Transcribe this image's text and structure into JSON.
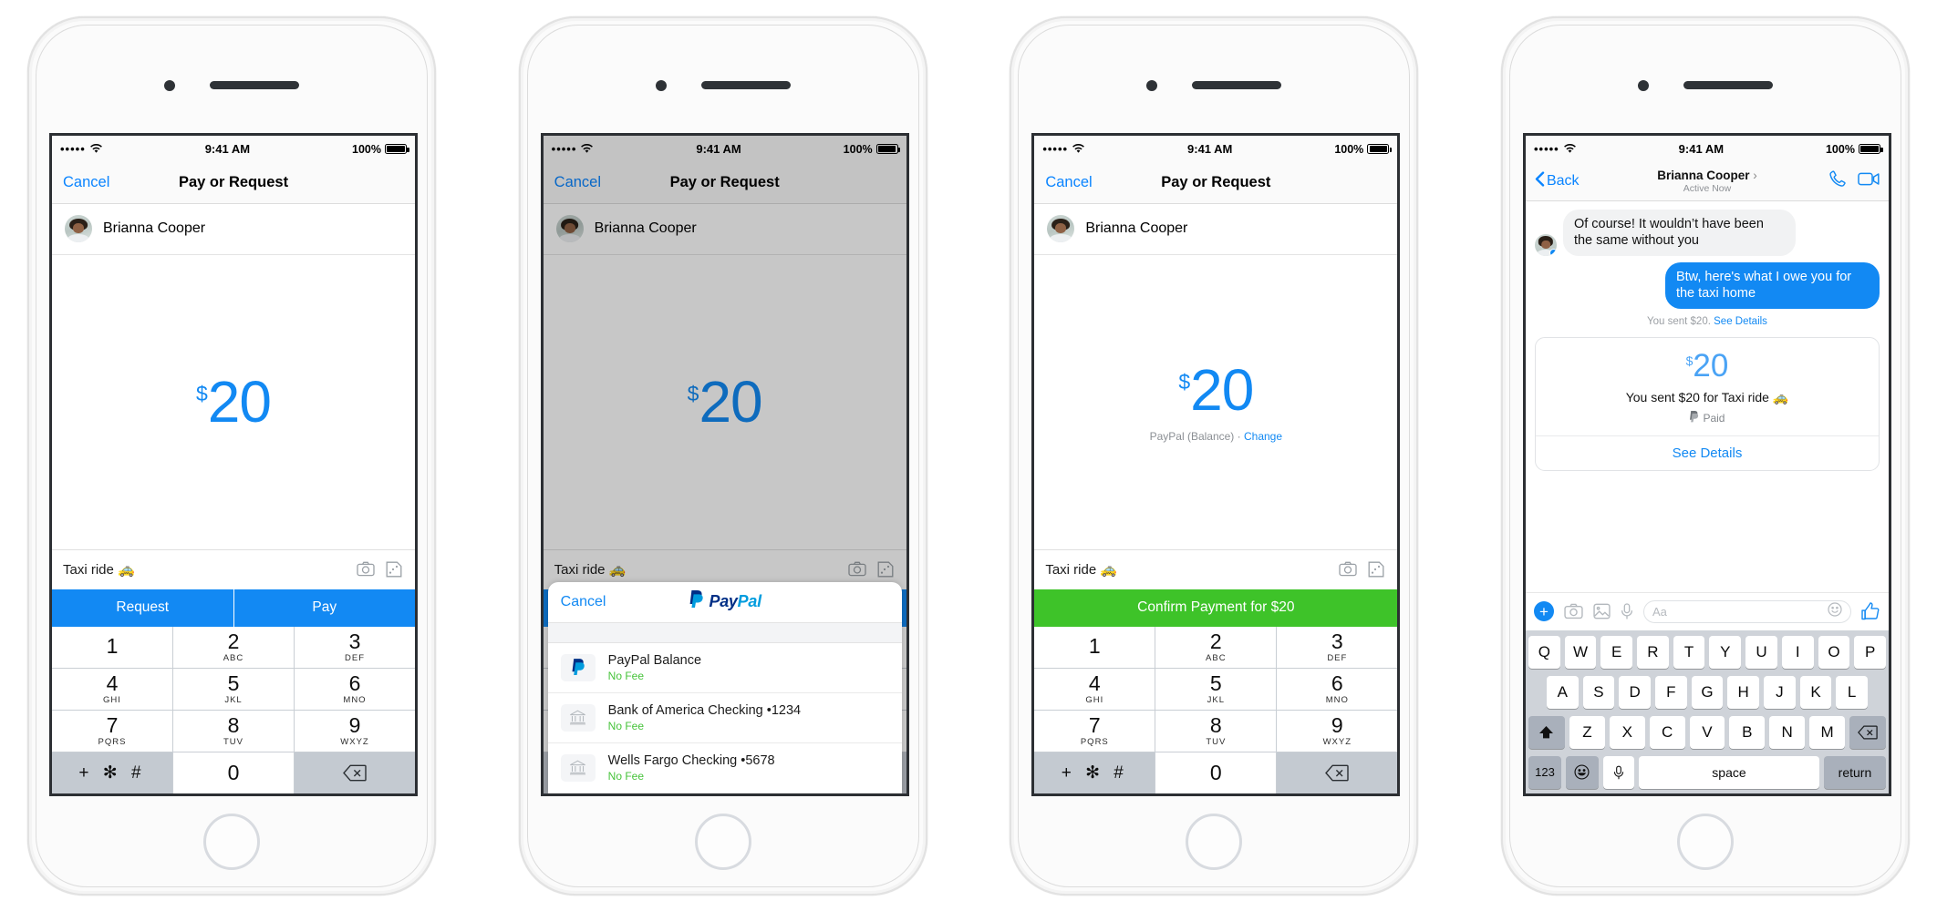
{
  "status_bar": {
    "signal_dots": "•••••",
    "wifi_icon": "wifi-icon",
    "time": "9:41 AM",
    "battery_percent": "100%"
  },
  "colors": {
    "ios_blue": "#1289f3",
    "link_blue": "#0a84ff",
    "confirm_green": "#3ec329",
    "fee_green": "#46c33a",
    "keypad_gray": "#c4cad1"
  },
  "amount": {
    "sign": "$",
    "value": "20"
  },
  "recipient": {
    "name": "Brianna Cooper"
  },
  "memo": {
    "text": "Taxi ride 🚕",
    "camera_icon": "camera-icon",
    "sticker_icon": "sticker-icon"
  },
  "keypad": {
    "keys": [
      {
        "num": "1",
        "sub": ""
      },
      {
        "num": "2",
        "sub": "ABC"
      },
      {
        "num": "3",
        "sub": "DEF"
      },
      {
        "num": "4",
        "sub": "GHI"
      },
      {
        "num": "5",
        "sub": "JKL"
      },
      {
        "num": "6",
        "sub": "MNO"
      },
      {
        "num": "7",
        "sub": "PQRS"
      },
      {
        "num": "8",
        "sub": "TUV"
      },
      {
        "num": "9",
        "sub": "WXYZ"
      }
    ],
    "symbol_key": "+ ✻ #",
    "zero_key": "0",
    "backspace_icon": "backspace-icon"
  },
  "screen1": {
    "nav": {
      "cancel": "Cancel",
      "title": "Pay or Request"
    },
    "actions": {
      "request": "Request",
      "pay": "Pay"
    }
  },
  "screen2": {
    "nav": {
      "cancel": "Cancel",
      "title": "Pay or Request"
    },
    "paypal_sheet": {
      "cancel": "Cancel",
      "logo_part1": "Pay",
      "logo_part2": "Pal",
      "logo_icon": "paypal-icon",
      "items": [
        {
          "icon": "paypal-icon",
          "title": "PayPal Balance",
          "fee": "No Fee"
        },
        {
          "icon": "bank-icon",
          "title": "Bank of America Checking •1234",
          "fee": "No Fee"
        },
        {
          "icon": "bank-icon",
          "title": "Wells Fargo Checking •5678",
          "fee": "No Fee"
        }
      ]
    }
  },
  "screen3": {
    "nav": {
      "cancel": "Cancel",
      "title": "Pay or Request"
    },
    "funding_source": "PayPal (Balance) · ",
    "funding_change": "Change",
    "confirm_button": "Confirm Payment for $20"
  },
  "screen4": {
    "nav": {
      "back": "Back",
      "contact": "Brianna Cooper",
      "chevron": "›",
      "presence": "Active Now",
      "call_icon": "phone-call-icon",
      "video_icon": "video-call-icon"
    },
    "messages": [
      {
        "from": "them",
        "text": "Of course! It wouldn’t have been the same without you"
      },
      {
        "from": "me",
        "text": "Btw, here's what I owe you for the taxi home"
      }
    ],
    "sent_note_text": "You sent $20. ",
    "sent_note_link": "See Details",
    "receipt": {
      "sign": "$",
      "value": "20",
      "description": "You sent $20 for Taxi ride 🚕",
      "status": "Paid",
      "status_icon": "paypal-mono-icon",
      "see_details": "See Details"
    },
    "composer": {
      "plus_icon": "plus-icon",
      "camera_icon": "camera-icon",
      "photos_icon": "photos-icon",
      "mic_icon": "microphone-icon",
      "placeholder": "Aa",
      "emoji_icon": "emoji-icon",
      "like_icon": "thumbs-up-icon"
    },
    "keyboard": {
      "row1": [
        "Q",
        "W",
        "E",
        "R",
        "T",
        "Y",
        "U",
        "I",
        "O",
        "P"
      ],
      "row2": [
        "A",
        "S",
        "D",
        "F",
        "G",
        "H",
        "J",
        "K",
        "L"
      ],
      "row3": [
        "Z",
        "X",
        "C",
        "V",
        "B",
        "N",
        "M"
      ],
      "shift_icon": "shift-icon",
      "backspace_icon": "backspace-icon",
      "numbers_key": "123",
      "emoji_key": "emoji-icon",
      "dictation_key": "microphone-icon",
      "space_key": "space",
      "return_key": "return"
    }
  }
}
